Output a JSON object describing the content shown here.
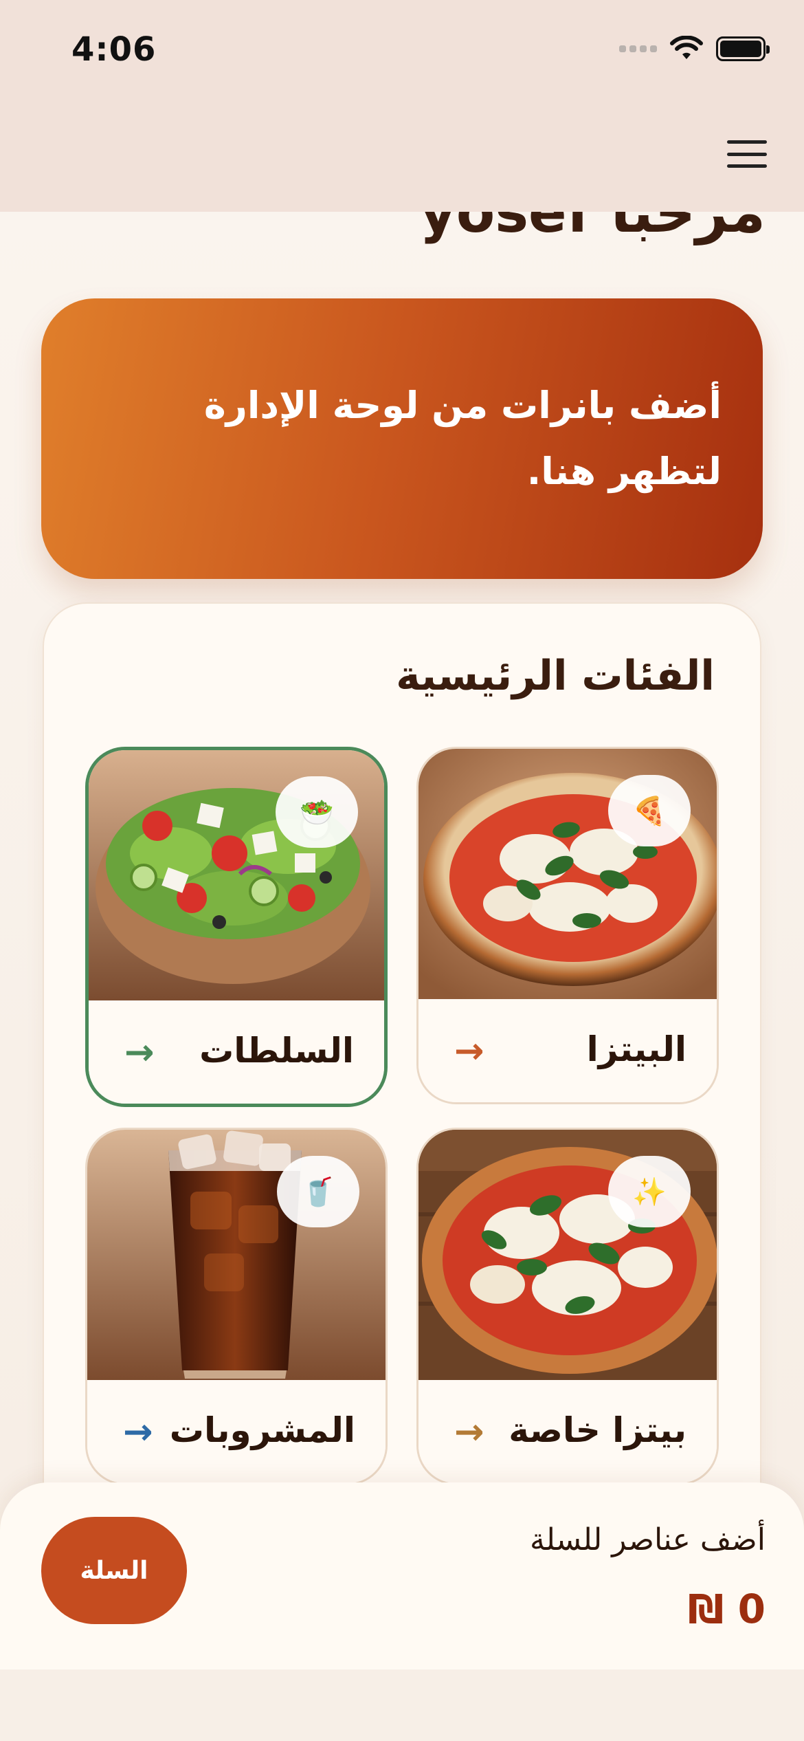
{
  "status_bar": {
    "time": "4:06"
  },
  "header": {
    "welcome": "مرحبا yosef"
  },
  "banner": {
    "text": "أضف بانرات من لوحة الإدارة لتظهر هنا."
  },
  "categories": {
    "title": "الفئات الرئيسية",
    "items": [
      {
        "label": "البيتزا",
        "badge": "🍕",
        "arrow": "→",
        "accent": "#c75b2a",
        "image": "pizza"
      },
      {
        "label": "السلطات",
        "badge": "🥗",
        "arrow": "→",
        "accent": "#4b8a5a",
        "image": "salad",
        "selected": true
      },
      {
        "label": "بيتزا خاصة",
        "badge": "✨",
        "arrow": "→",
        "accent": "#b37a35",
        "image": "special-pizza"
      },
      {
        "label": "المشروبات",
        "badge": "🥤",
        "arrow": "→",
        "accent": "#2e6aa6",
        "image": "soda"
      }
    ]
  },
  "cart": {
    "button_label": "السلة",
    "hint": "أضف عناصر للسلة",
    "total": "0 ₪"
  },
  "colors": {
    "primary": "#c54c1f",
    "dark_text": "#3a1d0f",
    "selected_border": "#4b8a5a",
    "header_bg": "#f1e1d9"
  }
}
